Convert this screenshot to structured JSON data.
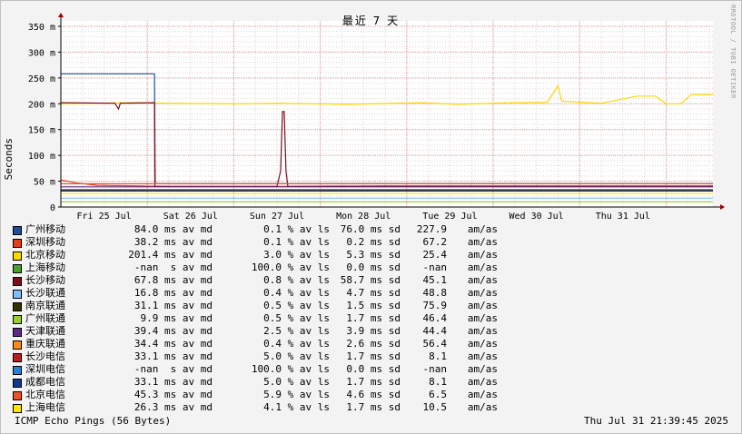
{
  "chart_data": {
    "type": "line",
    "title": "最近 7 天",
    "ylabel": "Seconds",
    "yticks": [
      0,
      50,
      100,
      150,
      200,
      250,
      300,
      350
    ],
    "ytick_labels": [
      "0",
      "50 m",
      "100 m",
      "150 m",
      "200 m",
      "250 m",
      "300 m",
      "350 m"
    ],
    "ylim": [
      0,
      350
    ],
    "xlim_hours": [
      0,
      181
    ],
    "xtick_labels": [
      "Fri 25 Jul",
      "Sat 26 Jul",
      "Sun 27 Jul",
      "Mon 28 Jul",
      "Tue 29 Jul",
      "Wed 30 Jul",
      "Thu 31 Jul"
    ],
    "xtick_label_hours": [
      12,
      36,
      60,
      84,
      108,
      132,
      156
    ],
    "grid": true,
    "series": [
      {
        "name": "广州移动",
        "color": "#1f4e99",
        "points": [
          [
            0,
            258
          ],
          [
            26,
            258
          ],
          [
            26.2,
            45
          ],
          [
            181,
            45
          ]
        ]
      },
      {
        "name": "深圳移动",
        "color": "#e0401a",
        "points": [
          [
            0,
            52
          ],
          [
            2,
            50
          ],
          [
            4,
            47
          ],
          [
            10,
            42
          ],
          [
            30,
            40
          ],
          [
            60,
            40
          ],
          [
            90,
            41
          ],
          [
            120,
            41
          ],
          [
            150,
            41
          ],
          [
            181,
            41
          ]
        ]
      },
      {
        "name": "北京移动",
        "color": "#ffd700",
        "points": [
          [
            0,
            200
          ],
          [
            20,
            202
          ],
          [
            30,
            201
          ],
          [
            50,
            200
          ],
          [
            60,
            201
          ],
          [
            80,
            199
          ],
          [
            100,
            202
          ],
          [
            110,
            199
          ],
          [
            125,
            202
          ],
          [
            135,
            203
          ],
          [
            138,
            235
          ],
          [
            139,
            205
          ],
          [
            150,
            201
          ],
          [
            160,
            215
          ],
          [
            165,
            215
          ],
          [
            168,
            200
          ],
          [
            172,
            200
          ],
          [
            175,
            218
          ],
          [
            181,
            218
          ]
        ]
      },
      {
        "name": "上海移动",
        "color": "#4aa02c",
        "points": []
      },
      {
        "name": "长沙移动",
        "color": "#7a0f1e",
        "points": [
          [
            0,
            202
          ],
          [
            15,
            201
          ],
          [
            16,
            190
          ],
          [
            16.5,
            201
          ],
          [
            26,
            202
          ],
          [
            26.1,
            40
          ],
          [
            60,
            40
          ],
          [
            61,
            70
          ],
          [
            61.5,
            185
          ],
          [
            62,
            185
          ],
          [
            62.5,
            70
          ],
          [
            63,
            40
          ],
          [
            181,
            40
          ]
        ]
      },
      {
        "name": "长沙联通",
        "color": "#7fbfff",
        "points": [
          [
            0,
            17
          ],
          [
            181,
            17
          ]
        ]
      },
      {
        "name": "南京联通",
        "color": "#333300",
        "points": [
          [
            0,
            31
          ],
          [
            181,
            31
          ]
        ]
      },
      {
        "name": "广州联通",
        "color": "#9acd32",
        "points": [
          [
            0,
            10
          ],
          [
            181,
            10
          ]
        ]
      },
      {
        "name": "天津联通",
        "color": "#5b2a86",
        "points": [
          [
            0,
            39
          ],
          [
            181,
            39
          ]
        ]
      },
      {
        "name": "重庆联通",
        "color": "#ff8c1a",
        "points": [
          [
            0,
            34
          ],
          [
            181,
            34
          ]
        ]
      },
      {
        "name": "长沙电信",
        "color": "#b22222",
        "points": [
          [
            0,
            33
          ],
          [
            181,
            33
          ]
        ]
      },
      {
        "name": "深圳电信",
        "color": "#2a7fd4",
        "points": []
      },
      {
        "name": "成都电信",
        "color": "#123a8a",
        "points": [
          [
            0,
            33
          ],
          [
            181,
            33
          ]
        ]
      },
      {
        "name": "北京电信",
        "color": "#e8552a",
        "points": [
          [
            0,
            45
          ],
          [
            181,
            45
          ]
        ]
      },
      {
        "name": "上海电信",
        "color": "#ffe600",
        "points": [
          [
            0,
            26
          ],
          [
            181,
            26
          ]
        ]
      }
    ]
  },
  "legend": [
    {
      "name": "广州移动",
      "avg": "84.0 ms av md",
      "loss": "0.1 % av ls",
      "sd": "76.0 ms sd",
      "ratio": "227.9",
      "unit": "am/as"
    },
    {
      "name": "深圳移动",
      "avg": "38.2 ms av md",
      "loss": "0.1 % av ls",
      "sd": "0.2 ms sd",
      "ratio": "67.2",
      "unit": "am/as"
    },
    {
      "name": "北京移动",
      "avg": "201.4 ms av md",
      "loss": "3.0 % av ls",
      "sd": "5.3 ms sd",
      "ratio": "25.4",
      "unit": "am/as"
    },
    {
      "name": "上海移动",
      "avg": "-nan  s av md",
      "loss": "100.0 % av ls",
      "sd": "0.0 ms sd",
      "ratio": "-nan",
      "unit": "am/as"
    },
    {
      "name": "长沙移动",
      "avg": "67.8 ms av md",
      "loss": "0.8 % av ls",
      "sd": "58.7 ms sd",
      "ratio": "45.1",
      "unit": "am/as"
    },
    {
      "name": "长沙联通",
      "avg": "16.8 ms av md",
      "loss": "0.4 % av ls",
      "sd": "4.7 ms sd",
      "ratio": "48.8",
      "unit": "am/as"
    },
    {
      "name": "南京联通",
      "avg": "31.1 ms av md",
      "loss": "0.5 % av ls",
      "sd": "1.5 ms sd",
      "ratio": "75.9",
      "unit": "am/as"
    },
    {
      "name": "广州联通",
      "avg": "9.9 ms av md",
      "loss": "0.5 % av ls",
      "sd": "1.7 ms sd",
      "ratio": "46.4",
      "unit": "am/as"
    },
    {
      "name": "天津联通",
      "avg": "39.4 ms av md",
      "loss": "2.5 % av ls",
      "sd": "3.9 ms sd",
      "ratio": "44.4",
      "unit": "am/as"
    },
    {
      "name": "重庆联通",
      "avg": "34.4 ms av md",
      "loss": "0.4 % av ls",
      "sd": "2.6 ms sd",
      "ratio": "56.4",
      "unit": "am/as"
    },
    {
      "name": "长沙电信",
      "avg": "33.1 ms av md",
      "loss": "5.0 % av ls",
      "sd": "1.7 ms sd",
      "ratio": "8.1",
      "unit": "am/as"
    },
    {
      "name": "深圳电信",
      "avg": "-nan  s av md",
      "loss": "100.0 % av ls",
      "sd": "0.0 ms sd",
      "ratio": "-nan",
      "unit": "am/as"
    },
    {
      "name": "成都电信",
      "avg": "33.1 ms av md",
      "loss": "5.0 % av ls",
      "sd": "1.7 ms sd",
      "ratio": "8.1",
      "unit": "am/as"
    },
    {
      "name": "北京电信",
      "avg": "45.3 ms av md",
      "loss": "5.9 % av ls",
      "sd": "4.6 ms sd",
      "ratio": "6.5",
      "unit": "am/as"
    },
    {
      "name": "上海电信",
      "avg": "26.3 ms av md",
      "loss": "4.1 % av ls",
      "sd": "1.7 ms sd",
      "ratio": "10.5",
      "unit": "am/as"
    }
  ],
  "footer": {
    "left": "ICMP Echo Pings (56 Bytes)",
    "right": "Thu Jul 31 21:39:45 2025"
  },
  "credit": "RRDTOOL / TOBI OETIKER"
}
